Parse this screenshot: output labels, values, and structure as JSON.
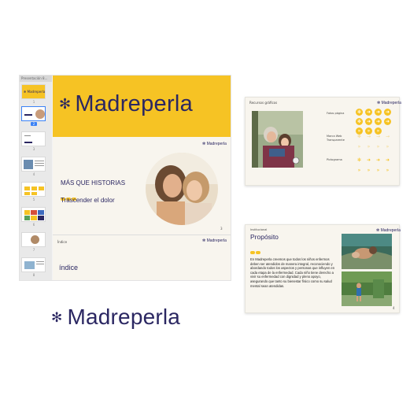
{
  "editor": {
    "doc_title": "Presentación 8...",
    "thumb_numbers": [
      "1",
      "2",
      "3",
      "4",
      "5",
      "6",
      "7",
      "8"
    ],
    "selected_thumb": 2
  },
  "cover": {
    "brand": "Madreperla",
    "star": "✻"
  },
  "hero": {
    "logo": "✻ Madreperla",
    "headline": "MÁS QUE HISTORIAS",
    "subline": "Trascender el dolor",
    "page_number": "3"
  },
  "index_slide": {
    "label": "Índice",
    "logo": "✻ Madreperla",
    "title": "índice"
  },
  "resources": {
    "title": "Recursos gráficos",
    "logo": "✻ Madreperla",
    "labels": [
      "Fotos página",
      "Marca Web Transparente",
      "Pictograma"
    ]
  },
  "purpose": {
    "kicker": "Institucional",
    "title": "Propósito",
    "logo": "✻ Madreperla",
    "body": "En Madreperla creemos que todos los niños enfermos deben ser atendidos de manera integral, reconociendo y abordando todos los aspectos y personas que influyen en cada etapa de la enfermedad. Cada niño tiene derecho a vivir su enfermedad con dignidad y pleno apoyo, asegurando que tanto su bienestar físico como su salud mental sean atendidas.",
    "page_number": "4"
  },
  "main_logo": {
    "brand": "Madreperla",
    "star": "✻"
  },
  "colors": {
    "accent": "#f6c324",
    "brand": "#2b2762",
    "background": "#f8f5ee"
  }
}
